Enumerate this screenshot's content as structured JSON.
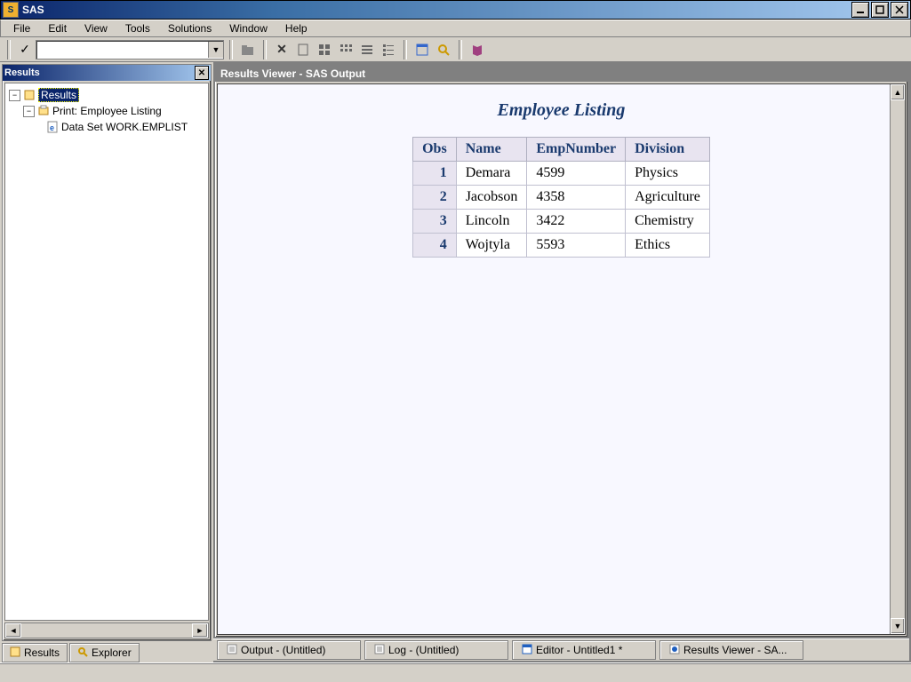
{
  "app": {
    "title": "SAS"
  },
  "menu": {
    "items": [
      "File",
      "Edit",
      "View",
      "Tools",
      "Solutions",
      "Window",
      "Help"
    ]
  },
  "toolbar": {
    "combo_value": "",
    "icons": [
      "folder-open-icon",
      "delete-icon",
      "new-icon",
      "grid-icon",
      "grid2-icon",
      "grid3-icon",
      "grid4-icon",
      "window-icon",
      "search-icon",
      "book-icon"
    ]
  },
  "results_panel": {
    "title": "Results",
    "tree": {
      "root": {
        "label": "Results"
      },
      "n1": {
        "label": "Print:  Employee Listing"
      },
      "n2": {
        "label": "Data Set WORK.EMPLIST"
      }
    }
  },
  "left_tabs": {
    "t0": {
      "label": "Results"
    },
    "t1": {
      "label": "Explorer"
    }
  },
  "viewer": {
    "window_title": "Results Viewer - SAS Output",
    "heading": "Employee Listing",
    "columns": {
      "c0": "Obs",
      "c1": "Name",
      "c2": "EmpNumber",
      "c3": "Division"
    },
    "rows": [
      {
        "obs": "1",
        "name": "Demara",
        "emp": "4599",
        "div": "Physics"
      },
      {
        "obs": "2",
        "name": "Jacobson",
        "emp": "4358",
        "div": "Agriculture"
      },
      {
        "obs": "3",
        "name": "Lincoln",
        "emp": "3422",
        "div": "Chemistry"
      },
      {
        "obs": "4",
        "name": "Wojtyla",
        "emp": "5593",
        "div": "Ethics"
      }
    ]
  },
  "bottom_tabs": {
    "b0": {
      "label": "Output - (Untitled)"
    },
    "b1": {
      "label": "Log - (Untitled)"
    },
    "b2": {
      "label": "Editor - Untitled1 *"
    },
    "b3": {
      "label": "Results Viewer - SA..."
    }
  }
}
